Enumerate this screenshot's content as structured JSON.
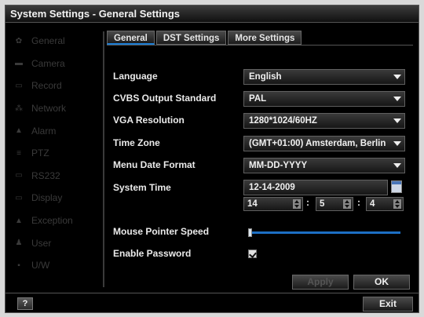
{
  "window": {
    "title": "System Settings - General Settings"
  },
  "sidebar": {
    "items": [
      {
        "label": "General",
        "icon": "gear-icon",
        "glyph": "✿"
      },
      {
        "label": "Camera",
        "icon": "camera-icon",
        "glyph": "▬"
      },
      {
        "label": "Record",
        "icon": "record-icon",
        "glyph": "▭"
      },
      {
        "label": "Network",
        "icon": "network-icon",
        "glyph": "⁂"
      },
      {
        "label": "Alarm",
        "icon": "alarm-icon",
        "glyph": "▲"
      },
      {
        "label": "PTZ",
        "icon": "ptz-icon",
        "glyph": "≡"
      },
      {
        "label": "RS232",
        "icon": "rs232-icon",
        "glyph": "▭"
      },
      {
        "label": "Display",
        "icon": "display-icon",
        "glyph": "▭"
      },
      {
        "label": "Exception",
        "icon": "exception-icon",
        "glyph": "▲"
      },
      {
        "label": "User",
        "icon": "user-icon",
        "glyph": "♟"
      },
      {
        "label": "U/W",
        "icon": "uw-icon",
        "glyph": "▪"
      }
    ]
  },
  "tabs": [
    {
      "label": "General",
      "active": true
    },
    {
      "label": "DST Settings",
      "active": false
    },
    {
      "label": "More Settings",
      "active": false
    }
  ],
  "form": {
    "language": {
      "label": "Language",
      "value": "English"
    },
    "cvbs": {
      "label": "CVBS Output Standard",
      "value": "PAL"
    },
    "vga": {
      "label": "VGA Resolution",
      "value": "1280*1024/60HZ"
    },
    "timezone": {
      "label": "Time Zone",
      "value": "(GMT+01:00) Amsterdam, Berlin"
    },
    "date_format": {
      "label": "Menu Date Format",
      "value": "MM-DD-YYYY"
    },
    "system_time": {
      "label": "System Time",
      "date": "12-14-2009",
      "hour": "14",
      "minute": "5",
      "second": "4",
      "separator": ":"
    },
    "mouse_speed": {
      "label": "Mouse Pointer Speed",
      "level": 0.0
    },
    "enable_password": {
      "label": "Enable Password",
      "checked": true
    }
  },
  "buttons": {
    "apply": "Apply",
    "ok": "OK",
    "exit": "Exit",
    "help": "?"
  },
  "colors": {
    "accent": "#1d6fc4",
    "background": "#000000",
    "text": "#eaeaea"
  }
}
